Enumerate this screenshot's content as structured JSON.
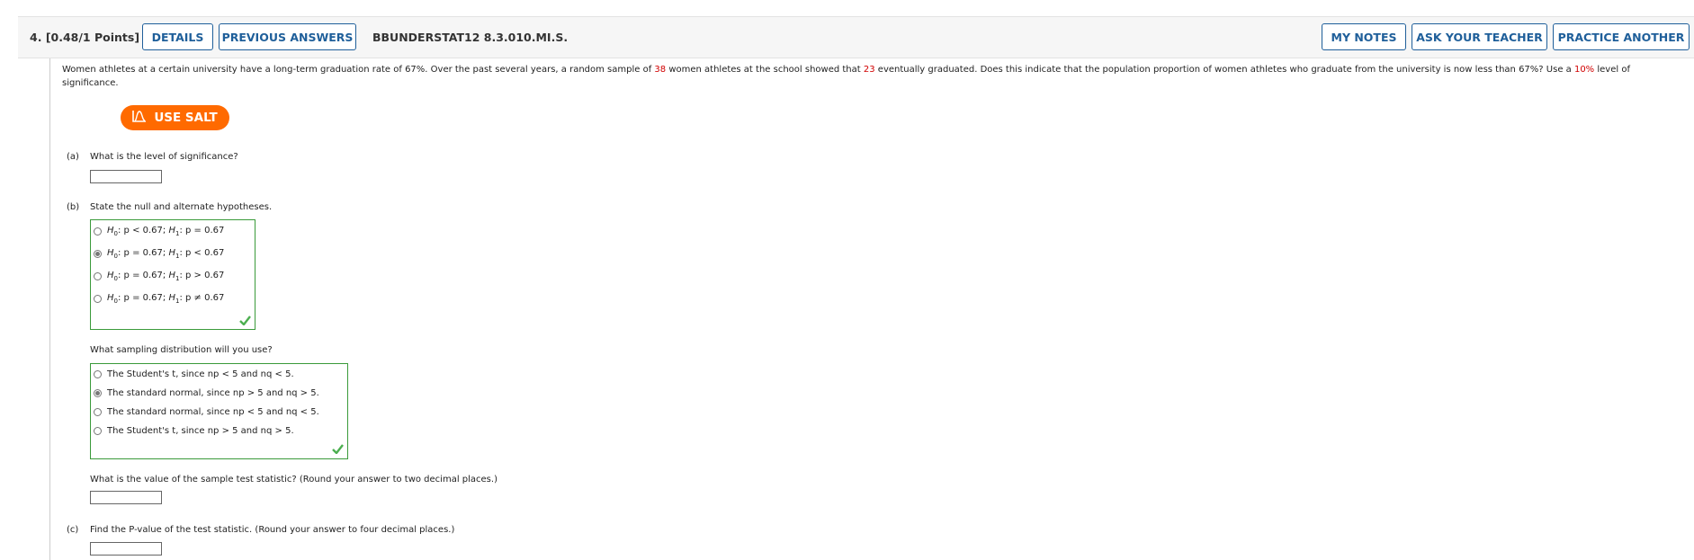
{
  "header": {
    "question_number": "4.",
    "points": "[0.48/1 Points]",
    "details_label": "DETAILS",
    "previous_answers_label": "PREVIOUS ANSWERS",
    "assignment_code": "BBUNDERSTAT12 8.3.010.MI.S.",
    "my_notes_label": "MY NOTES",
    "ask_teacher_label": "ASK YOUR TEACHER",
    "practice_another_label": "PRACTICE ANOTHER"
  },
  "problem": {
    "text_1": "Women athletes at a certain university have a long-term graduation rate of 67%. Over the past several years, a random sample of ",
    "sample_size": "38",
    "text_2": " women athletes at the school showed that ",
    "graduated": "23",
    "text_3": " eventually graduated. Does this indicate that the population proportion of women athletes who graduate from the university is now less than 67%? Use a ",
    "significance": "10%",
    "text_4": " level of significance."
  },
  "salt_button": {
    "label": "USE SALT",
    "icon": "salt-icon"
  },
  "part_a": {
    "label": "(a)",
    "question": "What is the level of significance?",
    "answer": ""
  },
  "part_b": {
    "label": "(b)",
    "question": "State the null and alternate hypotheses.",
    "hypotheses": [
      {
        "h0": ": p < 0.67; ",
        "h1": ": p = 0.67",
        "selected": false
      },
      {
        "h0": ": p = 0.67; ",
        "h1": ": p < 0.67",
        "selected": true
      },
      {
        "h0": ": p = 0.67; ",
        "h1": ": p > 0.67",
        "selected": false
      },
      {
        "h0": ": p = 0.67; ",
        "h1": ": p ≠ 0.67",
        "selected": false
      }
    ],
    "hypothesis_symbols": {
      "h0": "H",
      "h0_sub": "0",
      "h1": "H",
      "h1_sub": "1"
    },
    "sampling_question": "What sampling distribution will you use?",
    "sampling_options": [
      {
        "label": "The Student's t, since np < 5 and nq < 5.",
        "selected": false
      },
      {
        "label": "The standard normal, since np > 5 and nq > 5.",
        "selected": true
      },
      {
        "label": "The standard normal, since np < 5 and nq < 5.",
        "selected": false
      },
      {
        "label": "The Student's t, since np > 5 and nq > 5.",
        "selected": false
      }
    ],
    "test_stat_question": "What is the value of the sample test statistic? (Round your answer to two decimal places.)",
    "test_stat_answer": ""
  },
  "part_c": {
    "label": "(c)",
    "question": "Find the P-value of the test statistic. (Round your answer to four decimal places.)",
    "answer": ""
  },
  "colors": {
    "accent": "#1f5f9a",
    "salt": "#ff6a00",
    "correct": "#3a9a3a",
    "highlight": "#d10000"
  }
}
